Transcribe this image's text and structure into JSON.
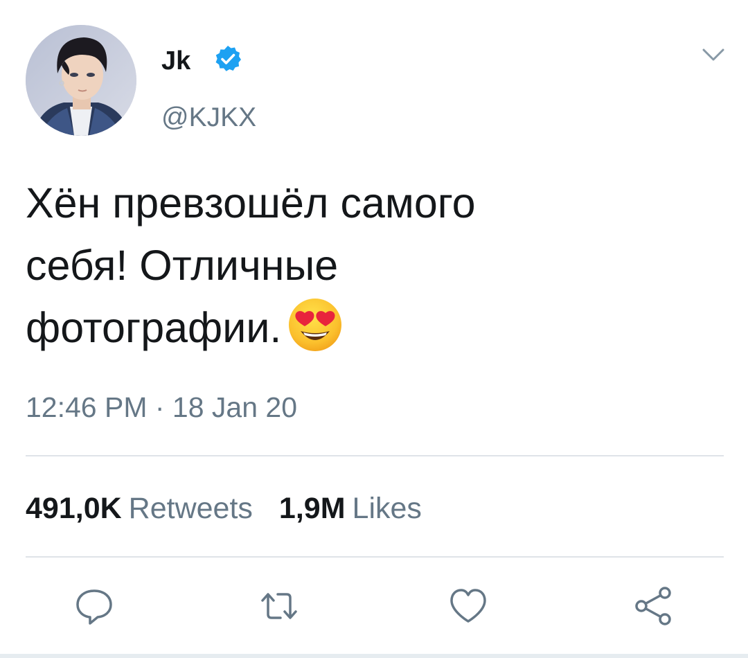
{
  "tweet": {
    "author": {
      "display_name": "Jk",
      "handle": "@KJKX",
      "verified": true,
      "avatar_icon": "profile-photo"
    },
    "text_lines": [
      "Хён превзошёл самого",
      "себя! Отличные",
      "фотографии."
    ],
    "emoji": "smiling-face-with-heart-eyes",
    "timestamp": "12:46 PM · 18 Jan 20",
    "stats": {
      "retweets_count": "491,0K",
      "retweets_label": "Retweets",
      "likes_count": "1,9M",
      "likes_label": "Likes"
    },
    "actions": {
      "reply_icon": "reply-icon",
      "retweet_icon": "retweet-icon",
      "like_icon": "heart-icon",
      "share_icon": "share-icon"
    }
  },
  "colors": {
    "text_primary": "#14171a",
    "text_secondary": "#657786",
    "verified_blue": "#1da1f2",
    "icon_gray": "#657786",
    "divider": "#dfe3e8"
  }
}
